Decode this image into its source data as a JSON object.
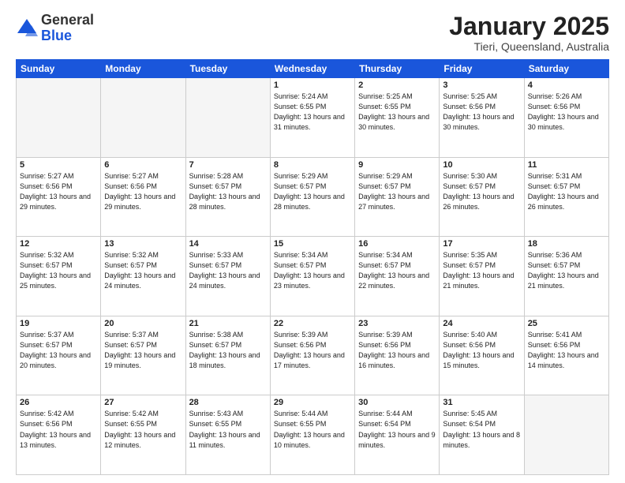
{
  "header": {
    "logo_line1": "General",
    "logo_line2": "Blue",
    "month": "January 2025",
    "location": "Tieri, Queensland, Australia"
  },
  "weekdays": [
    "Sunday",
    "Monday",
    "Tuesday",
    "Wednesday",
    "Thursday",
    "Friday",
    "Saturday"
  ],
  "weeks": [
    [
      {
        "day": "",
        "info": ""
      },
      {
        "day": "",
        "info": ""
      },
      {
        "day": "",
        "info": ""
      },
      {
        "day": "1",
        "info": "Sunrise: 5:24 AM\nSunset: 6:55 PM\nDaylight: 13 hours\nand 31 minutes."
      },
      {
        "day": "2",
        "info": "Sunrise: 5:25 AM\nSunset: 6:55 PM\nDaylight: 13 hours\nand 30 minutes."
      },
      {
        "day": "3",
        "info": "Sunrise: 5:25 AM\nSunset: 6:56 PM\nDaylight: 13 hours\nand 30 minutes."
      },
      {
        "day": "4",
        "info": "Sunrise: 5:26 AM\nSunset: 6:56 PM\nDaylight: 13 hours\nand 30 minutes."
      }
    ],
    [
      {
        "day": "5",
        "info": "Sunrise: 5:27 AM\nSunset: 6:56 PM\nDaylight: 13 hours\nand 29 minutes."
      },
      {
        "day": "6",
        "info": "Sunrise: 5:27 AM\nSunset: 6:56 PM\nDaylight: 13 hours\nand 29 minutes."
      },
      {
        "day": "7",
        "info": "Sunrise: 5:28 AM\nSunset: 6:57 PM\nDaylight: 13 hours\nand 28 minutes."
      },
      {
        "day": "8",
        "info": "Sunrise: 5:29 AM\nSunset: 6:57 PM\nDaylight: 13 hours\nand 28 minutes."
      },
      {
        "day": "9",
        "info": "Sunrise: 5:29 AM\nSunset: 6:57 PM\nDaylight: 13 hours\nand 27 minutes."
      },
      {
        "day": "10",
        "info": "Sunrise: 5:30 AM\nSunset: 6:57 PM\nDaylight: 13 hours\nand 26 minutes."
      },
      {
        "day": "11",
        "info": "Sunrise: 5:31 AM\nSunset: 6:57 PM\nDaylight: 13 hours\nand 26 minutes."
      }
    ],
    [
      {
        "day": "12",
        "info": "Sunrise: 5:32 AM\nSunset: 6:57 PM\nDaylight: 13 hours\nand 25 minutes."
      },
      {
        "day": "13",
        "info": "Sunrise: 5:32 AM\nSunset: 6:57 PM\nDaylight: 13 hours\nand 24 minutes."
      },
      {
        "day": "14",
        "info": "Sunrise: 5:33 AM\nSunset: 6:57 PM\nDaylight: 13 hours\nand 24 minutes."
      },
      {
        "day": "15",
        "info": "Sunrise: 5:34 AM\nSunset: 6:57 PM\nDaylight: 13 hours\nand 23 minutes."
      },
      {
        "day": "16",
        "info": "Sunrise: 5:34 AM\nSunset: 6:57 PM\nDaylight: 13 hours\nand 22 minutes."
      },
      {
        "day": "17",
        "info": "Sunrise: 5:35 AM\nSunset: 6:57 PM\nDaylight: 13 hours\nand 21 minutes."
      },
      {
        "day": "18",
        "info": "Sunrise: 5:36 AM\nSunset: 6:57 PM\nDaylight: 13 hours\nand 21 minutes."
      }
    ],
    [
      {
        "day": "19",
        "info": "Sunrise: 5:37 AM\nSunset: 6:57 PM\nDaylight: 13 hours\nand 20 minutes."
      },
      {
        "day": "20",
        "info": "Sunrise: 5:37 AM\nSunset: 6:57 PM\nDaylight: 13 hours\nand 19 minutes."
      },
      {
        "day": "21",
        "info": "Sunrise: 5:38 AM\nSunset: 6:57 PM\nDaylight: 13 hours\nand 18 minutes."
      },
      {
        "day": "22",
        "info": "Sunrise: 5:39 AM\nSunset: 6:56 PM\nDaylight: 13 hours\nand 17 minutes."
      },
      {
        "day": "23",
        "info": "Sunrise: 5:39 AM\nSunset: 6:56 PM\nDaylight: 13 hours\nand 16 minutes."
      },
      {
        "day": "24",
        "info": "Sunrise: 5:40 AM\nSunset: 6:56 PM\nDaylight: 13 hours\nand 15 minutes."
      },
      {
        "day": "25",
        "info": "Sunrise: 5:41 AM\nSunset: 6:56 PM\nDaylight: 13 hours\nand 14 minutes."
      }
    ],
    [
      {
        "day": "26",
        "info": "Sunrise: 5:42 AM\nSunset: 6:56 PM\nDaylight: 13 hours\nand 13 minutes."
      },
      {
        "day": "27",
        "info": "Sunrise: 5:42 AM\nSunset: 6:55 PM\nDaylight: 13 hours\nand 12 minutes."
      },
      {
        "day": "28",
        "info": "Sunrise: 5:43 AM\nSunset: 6:55 PM\nDaylight: 13 hours\nand 11 minutes."
      },
      {
        "day": "29",
        "info": "Sunrise: 5:44 AM\nSunset: 6:55 PM\nDaylight: 13 hours\nand 10 minutes."
      },
      {
        "day": "30",
        "info": "Sunrise: 5:44 AM\nSunset: 6:54 PM\nDaylight: 13 hours\nand 9 minutes."
      },
      {
        "day": "31",
        "info": "Sunrise: 5:45 AM\nSunset: 6:54 PM\nDaylight: 13 hours\nand 8 minutes."
      },
      {
        "day": "",
        "info": ""
      }
    ]
  ]
}
